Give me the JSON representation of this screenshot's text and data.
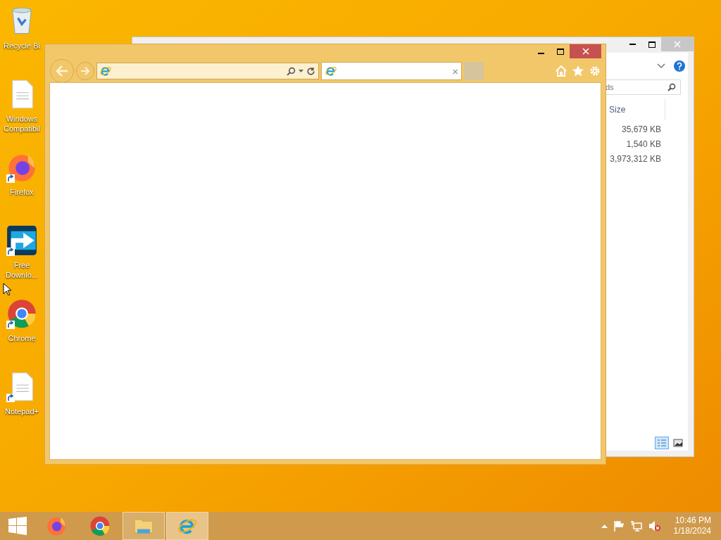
{
  "desktop_icons": [
    {
      "kind": "recycle",
      "label": "Recycle Bi",
      "shortcut": false
    },
    {
      "kind": "document",
      "label": "Windows Compatibil",
      "shortcut": false
    },
    {
      "kind": "firefox",
      "label": "Firefox",
      "shortcut": true
    },
    {
      "kind": "download",
      "label": "Free Downlo...",
      "shortcut": true
    },
    {
      "kind": "chrome",
      "label": "Chrome",
      "shortcut": true
    },
    {
      "kind": "document",
      "label": "Notepad+",
      "shortcut": true
    }
  ],
  "explorer": {
    "search_text": "ds",
    "columns": [
      "Size"
    ],
    "rows": [
      [
        "35,679 KB"
      ],
      [
        "1,540 KB"
      ],
      [
        "3,973,312 KB"
      ]
    ],
    "views": [
      {
        "kind": "details",
        "selected": true
      },
      {
        "kind": "icons",
        "selected": false
      }
    ]
  },
  "browser": {
    "tab": {
      "close": "×"
    }
  },
  "taskbar": {
    "items": [
      {
        "kind": "firefox",
        "running": false,
        "selected": false
      },
      {
        "kind": "chrome",
        "running": false,
        "selected": false
      },
      {
        "kind": "explorer",
        "running": true,
        "selected": false
      },
      {
        "kind": "ie",
        "running": true,
        "selected": true
      }
    ],
    "volume_muted": true,
    "time": "10:46 PM",
    "date": "1/18/2024"
  }
}
